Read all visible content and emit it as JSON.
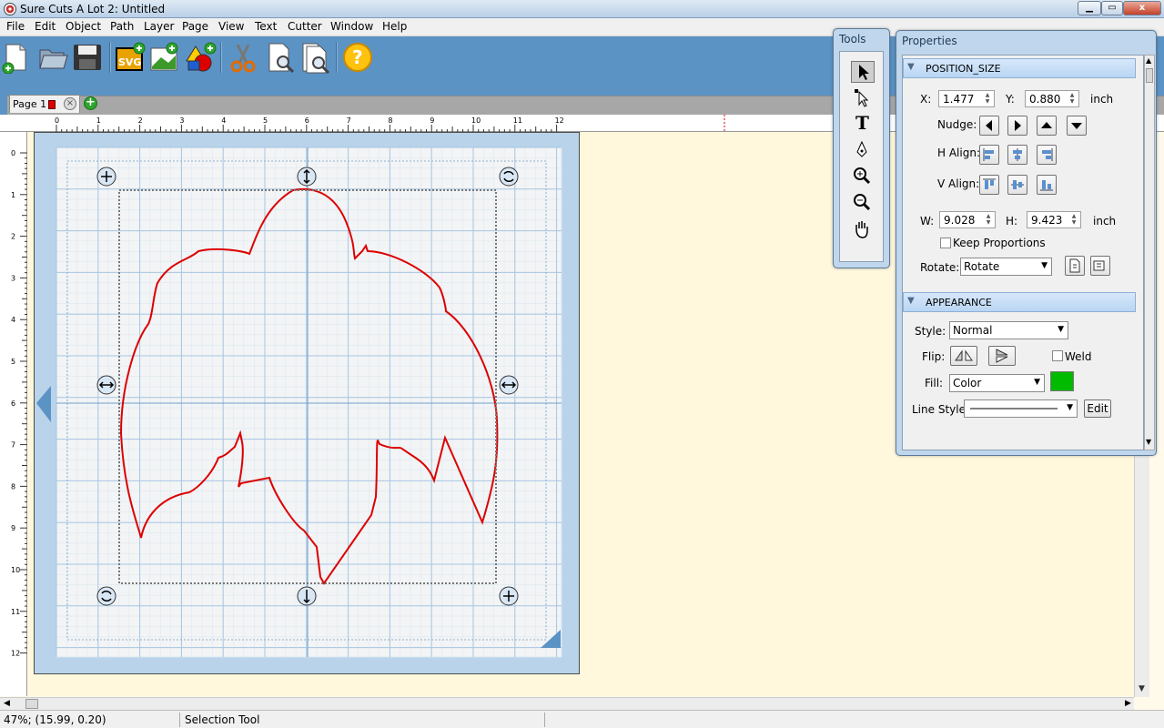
{
  "window": {
    "title": "Sure Cuts A Lot 2: Untitled",
    "minimize": "▁",
    "restore": "▭",
    "close": "x"
  },
  "menu": [
    "File",
    "Edit",
    "Object",
    "Path",
    "Layer",
    "Page",
    "View",
    "Text",
    "Cutter",
    "Window",
    "Help"
  ],
  "toolbar": {
    "buttons": [
      "new-document-icon",
      "open-folder-icon",
      "save-disk-icon",
      "import-svg-icon",
      "import-image-icon",
      "import-shapes-icon",
      "cut-scissors-icon",
      "preview-icon",
      "cut-preview-icon",
      "help-icon"
    ],
    "svg_label": "SVG",
    "help_label": "?"
  },
  "tabs": {
    "page_label": "Page 1",
    "close_glyph": "×",
    "add_glyph": "+",
    "page_color": "#dd0000"
  },
  "ruler": {
    "h_ticks": [
      "0",
      "1",
      "2",
      "3",
      "4",
      "5",
      "6",
      "7",
      "8",
      "9",
      "10",
      "11",
      "12"
    ],
    "v_ticks": [
      "0",
      "1",
      "2",
      "3",
      "4",
      "5",
      "6",
      "7",
      "8",
      "9",
      "10",
      "11",
      "12"
    ]
  },
  "tools": {
    "title": "Tools",
    "items": [
      "pointer-icon",
      "node-edit-icon",
      "text-tool-icon",
      "pen-tool-icon",
      "zoom-in-icon",
      "zoom-out-icon",
      "pan-hand-icon"
    ],
    "text_glyph": "T"
  },
  "properties": {
    "title": "Properties",
    "position_size": {
      "header": "POSITION_SIZE",
      "x_label": "X:",
      "x_value": "1.477",
      "y_label": "Y:",
      "y_value": "0.880",
      "unit": "inch",
      "nudge_label": "Nudge:",
      "halign_label": "H Align:",
      "valign_label": "V Align:",
      "w_label": "W:",
      "w_value": "9.028",
      "h_label": "H:",
      "h_value": "9.423",
      "unit2": "inch",
      "keep_proportions": "Keep Proportions",
      "rotate_label": "Rotate:",
      "rotate_value": "Rotate"
    },
    "appearance": {
      "header": "APPEARANCE",
      "style_label": "Style:",
      "style_value": "Normal",
      "flip_label": "Flip:",
      "weld_label": "Weld",
      "fill_label": "Fill:",
      "fill_value": "Color",
      "fill_color": "#00bb00",
      "line_style_label": "Line Style:",
      "edit_label": "Edit"
    }
  },
  "colors": {
    "toolbar_bg": "#5c93c5",
    "mat": "#b9d3ea",
    "shape_stroke": "#dd0000",
    "workspace": "#fff8dd"
  },
  "status": {
    "coords": "47%; (15.99, 0.20)",
    "tool": "Selection Tool"
  }
}
